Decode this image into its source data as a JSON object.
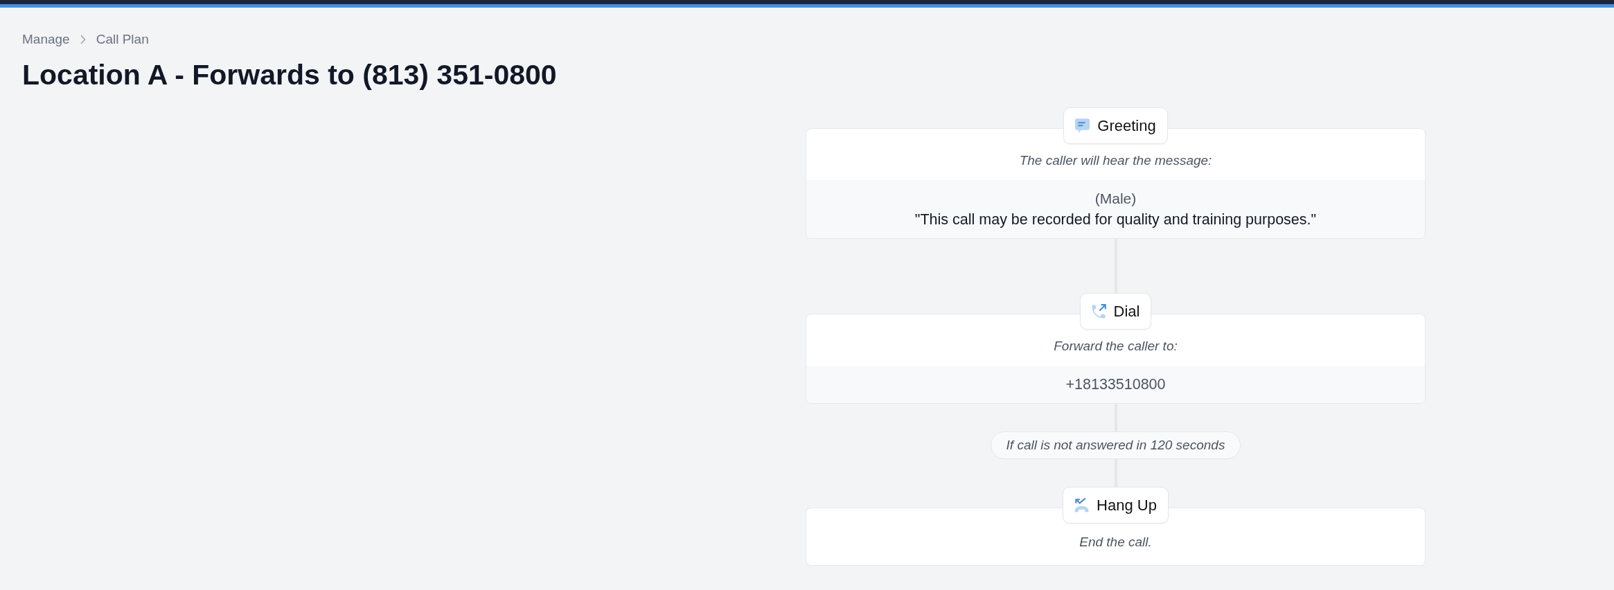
{
  "breadcrumb": [
    "Manage",
    "Call Plan"
  ],
  "title": "Location A - Forwards to (813) 351-0800",
  "flow": [
    {
      "kind": "greeting",
      "title": "Greeting",
      "description": "The caller will hear the message:",
      "details": [
        {
          "kind": "voice",
          "text": "(Male)"
        },
        {
          "kind": "message",
          "text": "\"This call may be recorded for quality and training purposes.\""
        }
      ]
    },
    {
      "kind": "dial",
      "title": "Dial",
      "description": "Forward the caller to:",
      "details": [
        {
          "kind": "number",
          "text": "+18133510800"
        }
      ]
    },
    {
      "kind": "condition",
      "text": "If call is not answered in 120 seconds"
    },
    {
      "kind": "hangup",
      "title": "Hang Up",
      "description": "End the call."
    }
  ]
}
